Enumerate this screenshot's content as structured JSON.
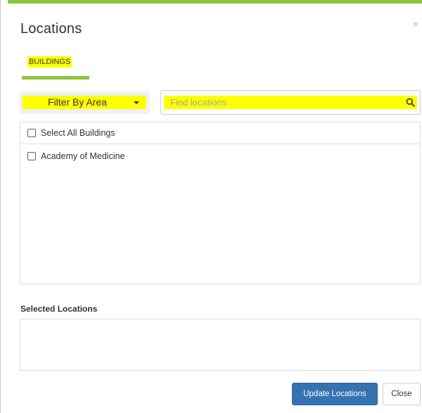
{
  "dialog": {
    "title": "Locations",
    "close_glyph": "×"
  },
  "tabs": [
    {
      "label": "BUILDINGS",
      "active": true
    }
  ],
  "filter": {
    "label": "Filter By Area"
  },
  "search": {
    "placeholder": "Find locations",
    "value": "",
    "icon": "search-icon"
  },
  "list": {
    "select_all_label": "Select All Buildings",
    "select_all_checked": false,
    "items": [
      {
        "label": "Academy of Medicine",
        "checked": false
      }
    ]
  },
  "selected": {
    "heading": "Selected Locations",
    "items": []
  },
  "footer": {
    "update_label": "Update Locations",
    "close_label": "Close"
  },
  "colors": {
    "accent_green": "#8dc63f",
    "highlight": "#ffff00",
    "primary_button": "#3572b0"
  }
}
